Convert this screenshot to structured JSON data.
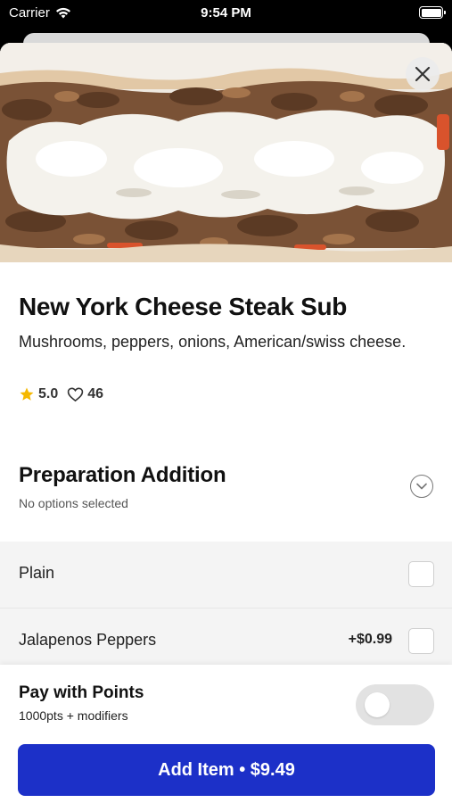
{
  "status_bar": {
    "carrier": "Carrier",
    "time": "9:54 PM",
    "wifi_icon": "wifi-icon",
    "battery_icon": "battery-icon"
  },
  "item": {
    "title": "New York Cheese Steak Sub",
    "description": "Mushrooms, peppers, onions, American/swiss cheese.",
    "rating": "5.0",
    "likes": "46",
    "close_icon": "close-icon",
    "star_icon": "star-icon",
    "heart_icon": "heart-icon",
    "star_color": "#F5B800"
  },
  "section": {
    "title": "Preparation Addition",
    "subtitle": "No options selected",
    "chevron_icon": "chevron-down-icon"
  },
  "options": [
    {
      "label": "Plain",
      "price": "",
      "checked": false
    },
    {
      "label": "Jalapenos Peppers",
      "price": "+$0.99",
      "checked": false
    }
  ],
  "footer": {
    "pay_title": "Pay with Points",
    "pay_subtitle": "1000pts + modifiers",
    "toggle_on": false,
    "add_button": "Add Item • $9.49",
    "accent_color": "#1C30C8"
  }
}
